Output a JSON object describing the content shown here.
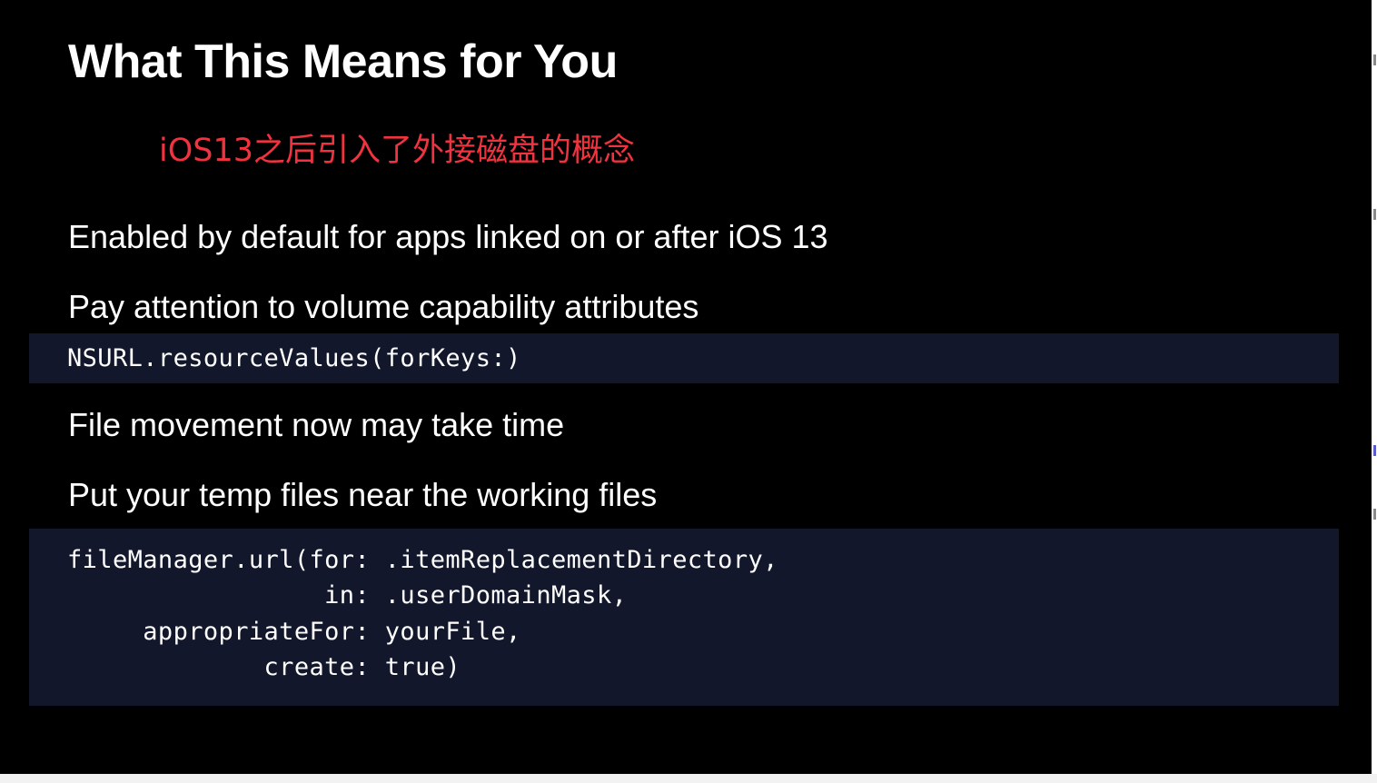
{
  "slide": {
    "title": "What This Means for You",
    "annotation": "iOS13之后引入了外接磁盘的概念",
    "annotation_color": "#f0333f",
    "bullets": [
      "Enabled by default for apps linked on or after iOS 13",
      "Pay attention to volume capability attributes",
      "File movement now may take time",
      "Put your temp files near the working files"
    ],
    "code1": [
      "NSURL.resourceValues(forKeys:)"
    ],
    "code2": [
      "fileManager.url(for: .itemReplacementDirectory,",
      "                 in: .userDomainMask,",
      "     appropriateFor: yourFile,",
      "             create: true)"
    ],
    "code_background": "#12172b",
    "background": "#000000"
  }
}
